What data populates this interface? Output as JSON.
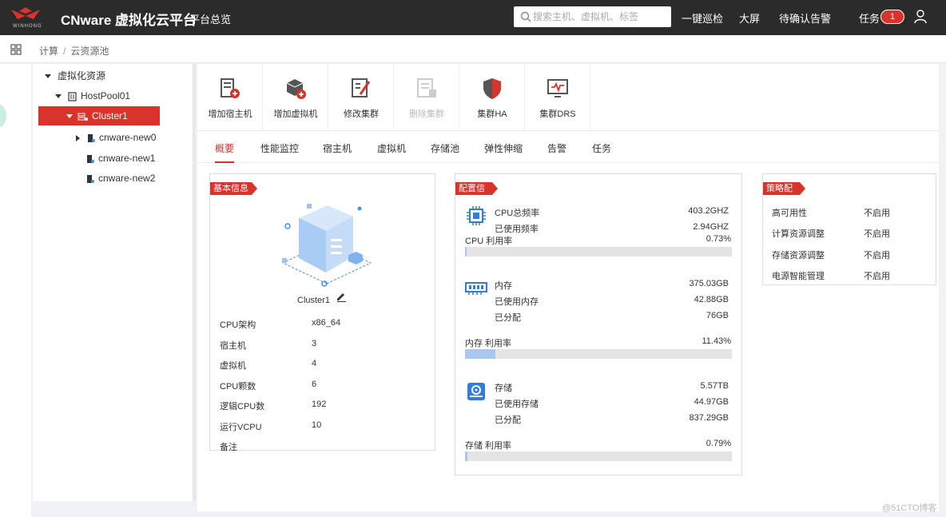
{
  "header": {
    "brand_text": "WINHONG",
    "title": "CNware 虚拟化云平台",
    "subtitle": "平台总览",
    "search_placeholder": "搜索主机、虚拟机、标签",
    "links": [
      "一键巡检",
      "大屏",
      "待确认告警"
    ],
    "task_label": "任务",
    "task_count": "1"
  },
  "breadcrumb": {
    "items": [
      "计算",
      "云资源池"
    ],
    "separator": "/"
  },
  "tree": {
    "root": "虚拟化资源",
    "pool": "HostPool01",
    "cluster": "Cluster1",
    "hosts": [
      "cnware-new0",
      "cnware-new1",
      "cnware-new2"
    ]
  },
  "toolbar": [
    {
      "label": "增加宿主机",
      "icon": "add-host-icon",
      "enabled": true
    },
    {
      "label": "增加虚拟机",
      "icon": "add-vm-icon",
      "enabled": true
    },
    {
      "label": "修改集群",
      "icon": "edit-cluster-icon",
      "enabled": true
    },
    {
      "label": "删除集群",
      "icon": "delete-cluster-icon",
      "enabled": false
    },
    {
      "label": "集群HA",
      "icon": "shield-icon",
      "enabled": true
    },
    {
      "label": "集群DRS",
      "icon": "monitor-icon",
      "enabled": true
    }
  ],
  "tabs": [
    "概要",
    "性能监控",
    "宿主机",
    "虚拟机",
    "存储池",
    "弹性伸缩",
    "告警",
    "任务"
  ],
  "basic": {
    "title": "基本信息",
    "cluster_name": "Cluster1",
    "rows": [
      {
        "label": "CPU架构",
        "value": "x86_64"
      },
      {
        "label": "宿主机",
        "value": "3"
      },
      {
        "label": "虚拟机",
        "value": "4"
      },
      {
        "label": "CPU颗数",
        "value": "6"
      },
      {
        "label": "逻辑CPU数",
        "value": "192"
      },
      {
        "label": "运行VCPU",
        "value": "10"
      },
      {
        "label": "备注",
        "value": ""
      }
    ]
  },
  "config": {
    "title": "配置信息",
    "cpu": {
      "rows": [
        {
          "label": "CPU总频率",
          "value": "403.2GHZ"
        },
        {
          "label": "已使用频率",
          "value": "2.94GHZ"
        }
      ],
      "usage_label": "CPU 利用率",
      "usage_text": "0.73%",
      "usage_pct": 0.73
    },
    "mem": {
      "rows": [
        {
          "label": "内存",
          "value": "375.03GB"
        },
        {
          "label": "已使用内存",
          "value": "42.88GB"
        },
        {
          "label": "已分配",
          "value": "76GB"
        }
      ],
      "usage_label": "内存 利用率",
      "usage_text": "11.43%",
      "usage_pct": 11.43
    },
    "storage": {
      "rows": [
        {
          "label": "存储",
          "value": "5.57TB"
        },
        {
          "label": "已使用存储",
          "value": "44.97GB"
        },
        {
          "label": "已分配",
          "value": "837.29GB"
        }
      ],
      "usage_label": "存储 利用率",
      "usage_text": "0.79%",
      "usage_pct": 0.79
    }
  },
  "policy": {
    "title": "策略配置",
    "rows": [
      {
        "label": "高可用性",
        "value": "不启用"
      },
      {
        "label": "计算资源调整",
        "value": "不启用"
      },
      {
        "label": "存储资源调整",
        "value": "不启用"
      },
      {
        "label": "电源智能管理",
        "value": "不启用"
      }
    ]
  },
  "watermark": "@51CTO博客",
  "colors": {
    "accent": "#d9342b",
    "topbar": "#2b2b2b",
    "bar_fill": "#a9c8f0"
  }
}
